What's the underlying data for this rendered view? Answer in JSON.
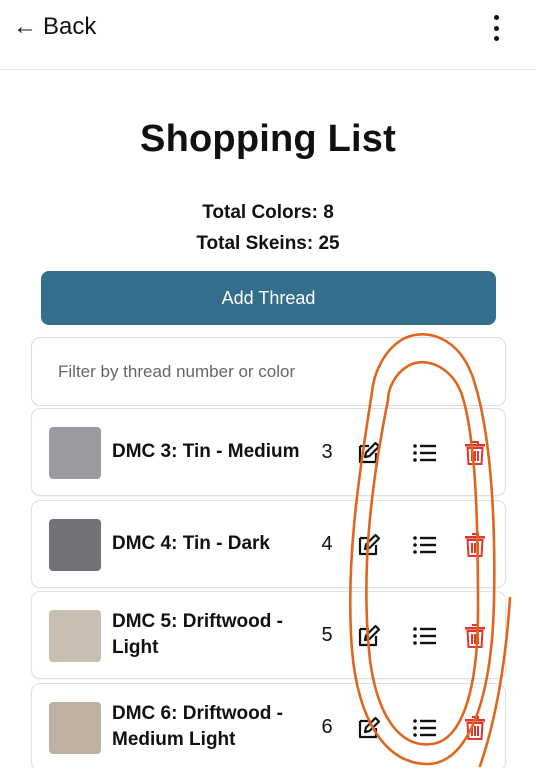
{
  "topbar": {
    "back_arrow": "←",
    "back_label": "Back",
    "menu_icon": "kebab-vertical-icon"
  },
  "page": {
    "title": "Shopping List",
    "total_colors": "Total Colors: 8",
    "total_skeins": "Total Skeins: 25"
  },
  "actions": {
    "add_thread_label": "Add Thread",
    "accent_color": "#336f8d"
  },
  "filter": {
    "placeholder": "Filter by thread number or color",
    "value": ""
  },
  "icons": {
    "edit": "edit-pencil-icon",
    "details": "list-icon",
    "delete": "trash-icon",
    "delete_color": "#e0362b"
  },
  "threads": [
    {
      "name": "DMC 3: Tin - Medium",
      "count": "3",
      "color": "#9a9ba0"
    },
    {
      "name": "DMC 4: Tin - Dark",
      "count": "4",
      "color": "#747177"
    },
    {
      "name": "DMC 5: Driftwood - Light",
      "count": "5",
      "color": "#c8bdb0"
    },
    {
      "name": "DMC 6: Driftwood - Medium Light",
      "count": "6",
      "color": "#beb1a1"
    }
  ],
  "annotation": {
    "description": "hand-drawn orange scribble loops around action icons",
    "color": "#e0661f"
  }
}
